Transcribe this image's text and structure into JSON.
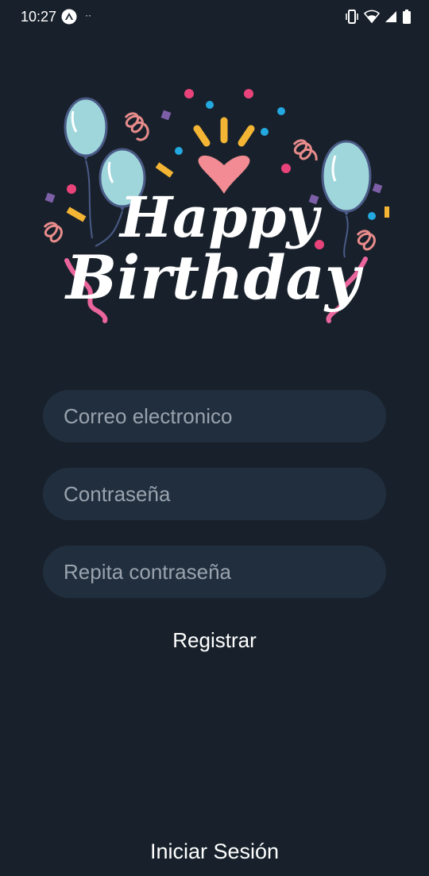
{
  "status_bar": {
    "time": "10:27",
    "app_icon": "expo-icon",
    "overflow": "··",
    "icons": [
      "vibrate-icon",
      "wifi-icon",
      "signal-icon",
      "battery-icon"
    ]
  },
  "banner": {
    "title_line1": "Happy",
    "title_line2": "Birthday",
    "colors": {
      "balloon": "#9fd6db",
      "balloon_outline": "#4a5a86",
      "heart": "#f28b93",
      "ray": "#f5b534",
      "confetti_pink": "#e8437a",
      "confetti_blue": "#23a8e0",
      "confetti_purple": "#7d5fa8",
      "ribbon": "#e9659c",
      "swirl": "#e88b8b"
    }
  },
  "form": {
    "email_placeholder": "Correo electronico",
    "password_placeholder": "Contraseña",
    "repeat_placeholder": "Repita contraseña",
    "register_label": "Registrar"
  },
  "footer": {
    "login_label": "Iniciar Sesión"
  },
  "colors": {
    "background": "#18212b",
    "field_background": "#202e3e",
    "placeholder": "#9aa3ad",
    "text": "#ffffff"
  }
}
